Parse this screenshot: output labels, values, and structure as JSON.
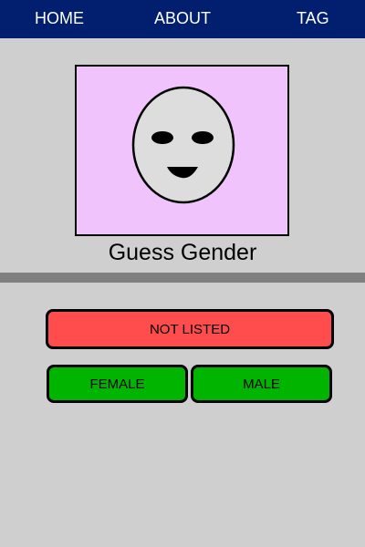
{
  "nav": {
    "items": [
      {
        "label": "HOME"
      },
      {
        "label": "ABOUT"
      },
      {
        "label": "TAG"
      }
    ],
    "background": "#011f6e"
  },
  "portrait": {
    "background": "#f0c3fd",
    "face_color": "#dddddd"
  },
  "title": "Guess Gender",
  "buttons": {
    "not_listed": {
      "label": "NOT LISTED",
      "color": "#ff4d4d"
    },
    "female": {
      "label": "FEMALE",
      "color": "#00b400"
    },
    "male": {
      "label": "MALE",
      "color": "#00b400"
    }
  },
  "page": {
    "background": "#cfcfcf",
    "divider_color": "#808080"
  }
}
